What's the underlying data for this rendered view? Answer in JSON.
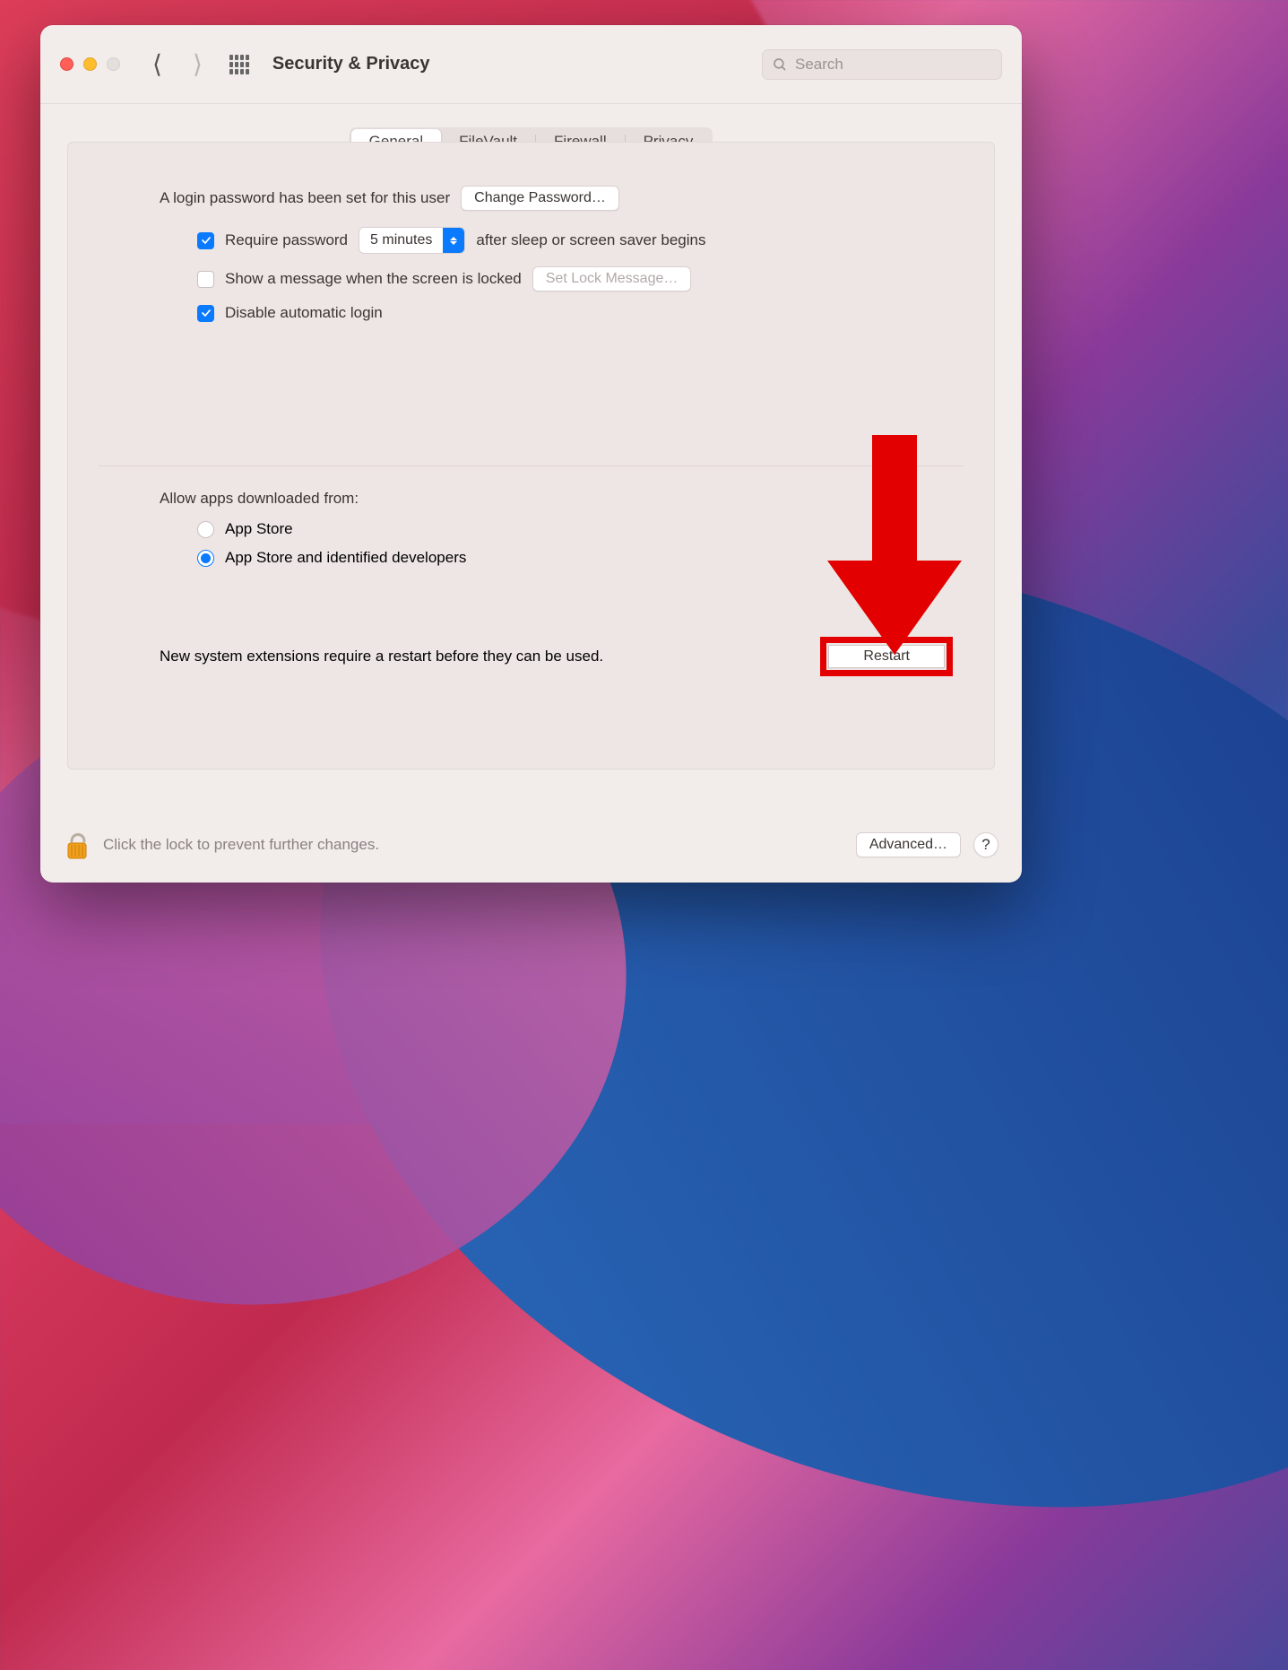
{
  "header": {
    "title": "Security & Privacy",
    "search_placeholder": "Search"
  },
  "tabs": [
    {
      "label": "General",
      "active": true
    },
    {
      "label": "FileVault",
      "active": false
    },
    {
      "label": "Firewall",
      "active": false
    },
    {
      "label": "Privacy",
      "active": false
    }
  ],
  "general": {
    "login_password_text": "A login password has been set for this user",
    "change_password_label": "Change Password…",
    "require_password_checked": true,
    "require_password_label": "Require password",
    "require_password_delay": "5 minutes",
    "after_sleep_text": "after sleep or screen saver begins",
    "show_message_checked": false,
    "show_message_label": "Show a message when the screen is locked",
    "set_lock_message_label": "Set Lock Message…",
    "disable_auto_login_checked": true,
    "disable_auto_login_label": "Disable automatic login"
  },
  "allow_apps": {
    "section_label": "Allow apps downloaded from:",
    "options": [
      {
        "label": "App Store",
        "selected": false
      },
      {
        "label": "App Store and identified developers",
        "selected": true
      }
    ]
  },
  "extensions": {
    "message": "New system extensions require a restart before they can be used.",
    "restart_label": "Restart"
  },
  "footer": {
    "lock_text": "Click the lock to prevent further changes.",
    "advanced_label": "Advanced…",
    "help_label": "?"
  },
  "annotation": {
    "arrow_color": "#e30000"
  }
}
